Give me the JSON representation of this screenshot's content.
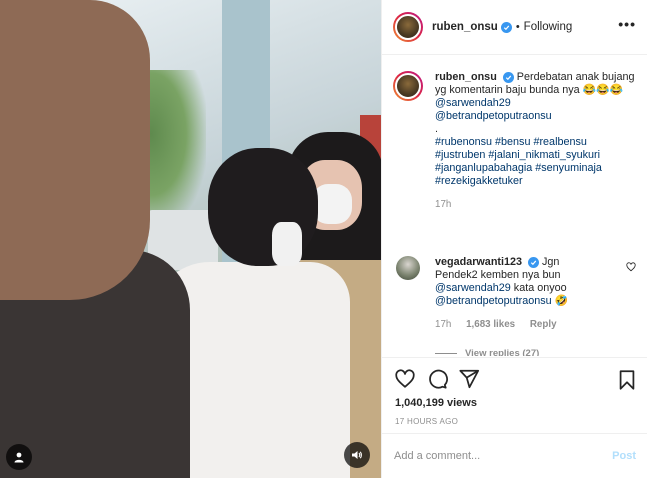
{
  "header": {
    "username": "ruben_onsu",
    "separator": "•",
    "follow_status": "Following",
    "more_label": "•••"
  },
  "caption": {
    "username": "ruben_onsu",
    "text": "Perdebatan anak bujang yg komentarin baju bunda nya 😂😂😂",
    "mentions": [
      "@sarwendah29",
      "@betrandpetoputraonsu"
    ],
    "dot": ".",
    "hashtags": "#rubenonsu #bensu #realbensu #justruben #jalani_nikmati_syukuri #janganlupabahagia #senyuminaja #rezekigakketuker",
    "time": "17h"
  },
  "comment": {
    "username": "vegadarwanti123",
    "text_before": "Jgn Pendek2 kemben nya bun",
    "mention1": "@sarwendah29",
    "text_after": "kata onyoo",
    "mention2": "@betrandpetoputraonsu",
    "emoji": "🤣",
    "time": "17h",
    "likes": "1,683 likes",
    "reply": "Reply",
    "view_replies": "View replies (27)"
  },
  "stats": {
    "views": "1,040,199 views",
    "timestamp": "17 HOURS AGO"
  },
  "composer": {
    "placeholder": "Add a comment...",
    "post_label": "Post"
  },
  "icons": {
    "verified": "verified-badge-icon",
    "like": "heart-icon",
    "comment": "comment-bubble-icon",
    "share": "paper-plane-icon",
    "save": "bookmark-icon",
    "user_tag": "user-tag-icon",
    "audio": "speaker-icon"
  },
  "colors": {
    "verified_blue": "#3897f0",
    "link": "#00376b",
    "muted": "#8e8e8e",
    "post_disabled": "#b2dffc"
  }
}
